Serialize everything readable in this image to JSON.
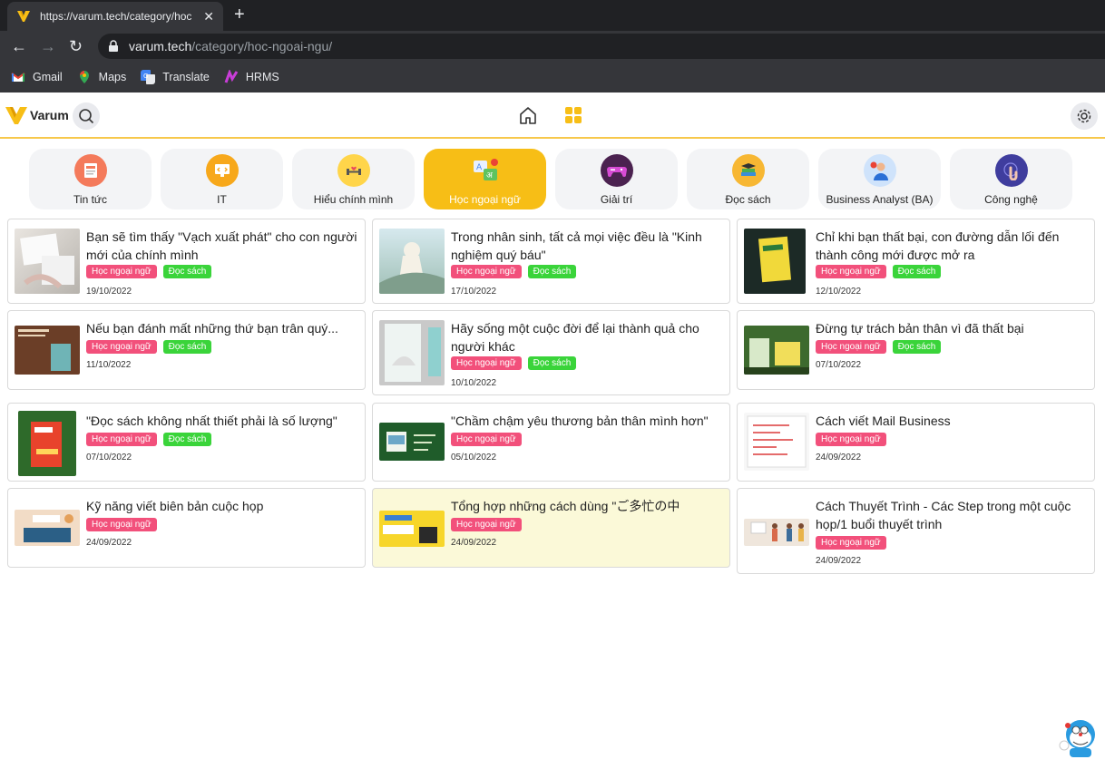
{
  "browser": {
    "tab_title": "https://varum.tech/category/hoc",
    "url_host": "varum.tech",
    "url_path": "/category/hoc-ngoai-ngu/",
    "bookmarks": [
      {
        "label": "Gmail",
        "icon": "gmail-icon"
      },
      {
        "label": "Maps",
        "icon": "maps-icon"
      },
      {
        "label": "Translate",
        "icon": "translate-icon"
      },
      {
        "label": "HRMS",
        "icon": "hrms-icon"
      }
    ]
  },
  "site": {
    "logo_text": "Varum",
    "accent_color": "#f7be16"
  },
  "categories": [
    {
      "label": "Tin tức",
      "icon": "news-icon",
      "active": false
    },
    {
      "label": "IT",
      "icon": "monitor-code-icon",
      "active": false
    },
    {
      "label": "Hiểu chính mình",
      "icon": "fitness-icon",
      "active": false
    },
    {
      "label": "Học ngoại ngữ",
      "icon": "language-icon",
      "active": true
    },
    {
      "label": "Giải trí",
      "icon": "gamepad-icon",
      "active": false
    },
    {
      "label": "Đọc sách",
      "icon": "books-icon",
      "active": false
    },
    {
      "label": "Business Analyst (BA)",
      "icon": "analyst-icon",
      "active": false
    },
    {
      "label": "Công nghệ",
      "icon": "tech-icon",
      "active": false
    }
  ],
  "tag_labels": {
    "lang": "Học ngoại ngữ",
    "read": "Đọc sách"
  },
  "articles": [
    {
      "title": "Bạn sẽ tìm thấy \"Vạch xuất phát\" cho con người mới của chính mình",
      "date": "19/10/2022"
    },
    {
      "title": "Trong nhân sinh, tất cả mọi việc đều là \"Kinh nghiệm quý báu\"",
      "date": "17/10/2022"
    },
    {
      "title": "Chỉ khi bạn thất bại, con đường dẫn lối đến thành công mới được mở ra",
      "date": "12/10/2022"
    },
    {
      "title": "Nếu bạn đánh mất những thứ bạn trân quý...",
      "date": "11/10/2022"
    },
    {
      "title": "Hãy sống một cuộc đời để lại thành quả cho người khác",
      "date": "10/10/2022"
    },
    {
      "title": "Đừng tự trách bản thân vì đã thất bại",
      "date": "07/10/2022"
    },
    {
      "title": "\"Đọc sách không nhất thiết phải là số lượng\"",
      "date": "07/10/2022"
    },
    {
      "title": "\"Chầm chậm yêu thương bản thân mình hơn\"",
      "date": "05/10/2022"
    },
    {
      "title": "Cách viết Mail Business",
      "date": "24/09/2022"
    },
    {
      "title": "Kỹ năng viết biên bản cuộc họp",
      "date": "24/09/2022"
    },
    {
      "title": "Tổng hợp những cách dùng \"ご多忙の中",
      "date": "24/09/2022"
    },
    {
      "title": "Cách Thuyết Trình - Các Step trong một cuộc họp/1 buổi thuyết trình",
      "date": "24/09/2022"
    }
  ]
}
